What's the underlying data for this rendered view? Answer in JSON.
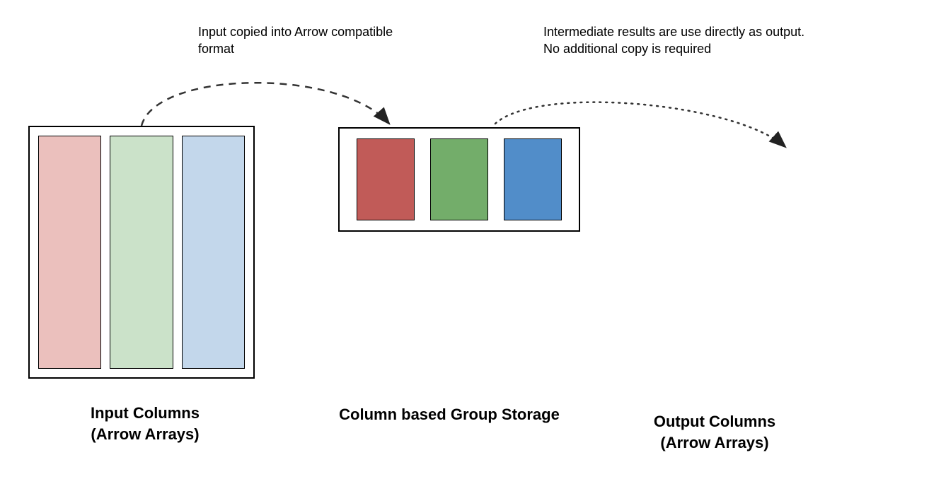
{
  "annotations": {
    "copy": "Input copied into Arrow compatible\nformat",
    "output": "Intermediate results are use directly as output.\nNo additional copy is required"
  },
  "captions": {
    "input": "Input Columns\n(Arrow Arrays)",
    "storage": "Column based Group Storage",
    "output": "Output Columns\n(Arrow Arrays)"
  },
  "colors": {
    "light_red": "#ebc0bd",
    "light_green": "#cbe2c9",
    "light_blue": "#c3d7eb",
    "red": "#c15b58",
    "green": "#73ad6a",
    "blue": "#518dc9"
  }
}
